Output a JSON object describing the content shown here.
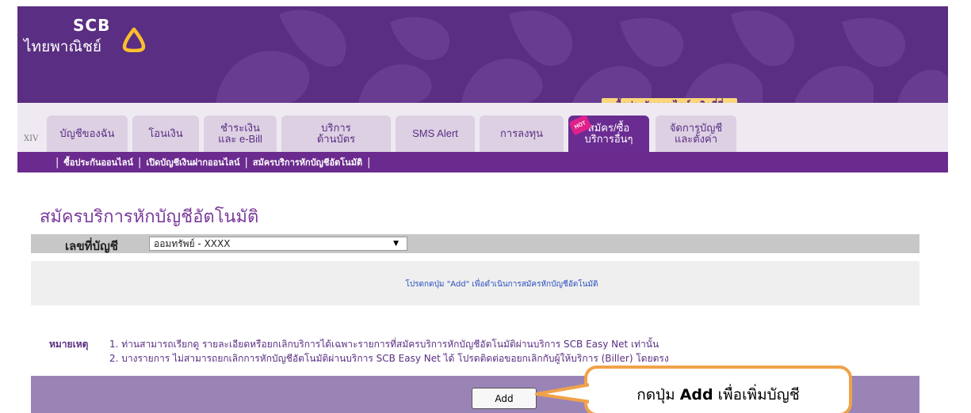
{
  "brand": {
    "en": "SCB",
    "th": "ไทยพาณิชย์"
  },
  "header": {
    "promo": "ซื้อประกันออนไลน์ คลิกที่นี่",
    "edge_label": "XIV",
    "hot_badge": "HOT"
  },
  "tabs": [
    {
      "label": "บัญชีของฉัน"
    },
    {
      "label": "โอนเงิน"
    },
    {
      "label": "ชำระเงิน\nและ e-Bill"
    },
    {
      "label": "บริการ\nด้านบัตร"
    },
    {
      "label": "SMS Alert"
    },
    {
      "label": "การลงทุน"
    },
    {
      "label": "สมัคร/ซื้อ\nบริการอื่นๆ",
      "active": true
    },
    {
      "label": "จัดการบัญชี\nและตั้งค่า"
    }
  ],
  "subnav": [
    {
      "label": "ซื้อประกันออนไลน์"
    },
    {
      "label": "เปิดบัญชีเงินฝากออนไลน์"
    },
    {
      "label": "สมัครบริการหักบัญชีอัตโนมัติ"
    }
  ],
  "main": {
    "title": "สมัครบริการหักบัญชีอัตโนมัติ",
    "account_label": "เลขที่บัญชี",
    "account_value": "ออมทรัพย์ - XXXX",
    "info": "โปรดกดปุ่ม \"Add\" เพื่อดำเนินการสมัครหักบัญชีอัตโนมัติ",
    "note_label": "หมายเหตุ",
    "note1": "1.  ท่านสามารถเรียกดู รายละเอียดหรือยกเลิกบริการได้เฉพาะรายการที่สมัครบริการหักบัญชีอัตโนมัติผ่านบริการ SCB Easy Net เท่านั้น",
    "note2": "2.  บางรายการ ไม่สามารถยกเลิกการหักบัญชีอัตโนมัติผ่านบริการ SCB Easy Net ได้ โปรดติดต่อขอยกเลิกกับผู้ให้บริการ (Biller) โดยตรง",
    "add_button": "Add"
  },
  "callout": {
    "prefix": "กดปุ่ม ",
    "bold": "Add",
    "suffix": " เพื่อเพิ่มบัญชี"
  },
  "colors": {
    "brand_purple": "#5a2e82",
    "tab_active": "#6a2c91",
    "promo_bg": "#fbd67a",
    "callout_border": "#f0a24a"
  }
}
